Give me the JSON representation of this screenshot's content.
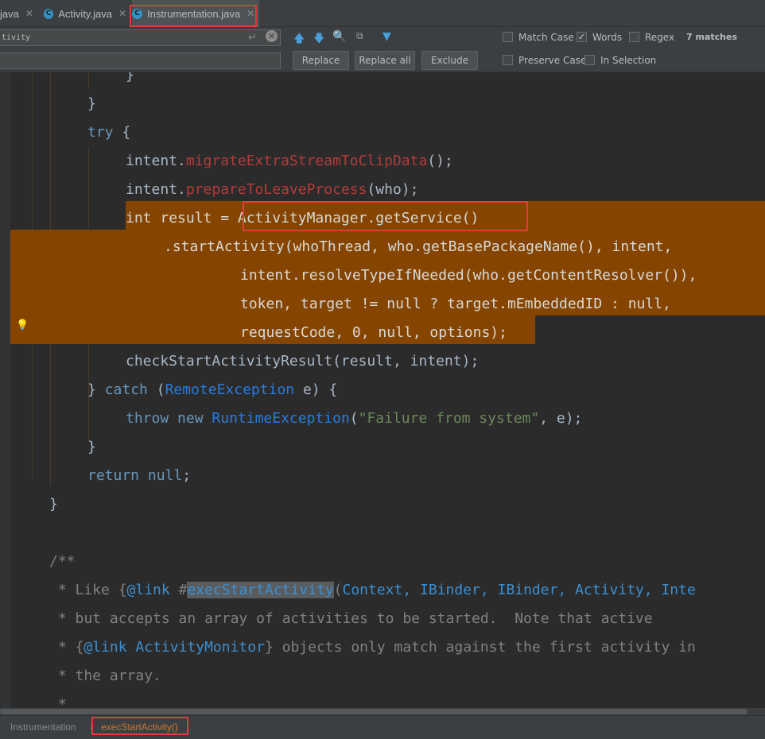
{
  "tabs": [
    {
      "label": "java",
      "active": false
    },
    {
      "label": "Activity.java",
      "active": false
    },
    {
      "label": "Instrumentation.java",
      "active": true
    }
  ],
  "find": {
    "search_value": "tivity",
    "replace_value": "",
    "replace_label": "Replace",
    "replace_all_label": "Replace all",
    "exclude_label": "Exclude",
    "match_case_label": "Match Case",
    "words_label": "Words",
    "regex_label": "Regex",
    "preserve_case_label": "Preserve Case",
    "in_selection_label": "In Selection",
    "matches": "7 matches",
    "match_case_checked": false,
    "words_checked": true,
    "regex_checked": false,
    "preserve_case_checked": false,
    "in_selection_checked": false
  },
  "code": {
    "l0": "}",
    "l1": "}",
    "l2_kw": "try",
    "l2_rest": " {",
    "l3_a": "intent.",
    "l3_m": "migrateExtraStreamToClipData",
    "l3_b": "();",
    "l4_a": "intent.",
    "l4_m": "prepareToLeaveProcess",
    "l4_b": "(who);",
    "l5_kw": "int",
    "l5_a": " result = ",
    "l5_b": "ActivityManager.getService()",
    "l6": ".startActivity(whoThread, who.getBasePackageName(), intent,",
    "l7": "intent.resolveTypeIfNeeded(who.getContentResolver()),",
    "l8_a": "token, target != ",
    "l8_n1": "null",
    "l8_b": " ? target.mEmbeddedID : ",
    "l8_n2": "null",
    "l8_c": ",",
    "l9_a": "requestCode, 0, ",
    "l9_n": "null",
    "l9_b": ", options);",
    "l10": "checkStartActivityResult(result, intent);",
    "l11_a": "} ",
    "l11_kw": "catch",
    "l11_b": " (",
    "l11_cls": "RemoteException",
    "l11_c": " e) {",
    "l12_kw1": "throw",
    "l12_sp1": " ",
    "l12_kw2": "new",
    "l12_sp2": " ",
    "l12_cls": "RuntimeException",
    "l12_a": "(",
    "l12_str": "\"Failure from system\"",
    "l12_b": ", e);",
    "l13": "}",
    "l14_kw": "return",
    "l14_sp": " ",
    "l14_null": "null",
    "l14_b": ";",
    "l15": "}",
    "l16": "/**",
    "l17_a": " * Like {",
    "l17_tag": "@link",
    "l17_b": " #",
    "l17_match": "execStartActivity",
    "l17_c": "(",
    "l17_d": "Context, IBinder, IBinder, Activity, Inte",
    "l18": " * but accepts an array of activities to be started.  Note that active",
    "l19_a": " * {",
    "l19_tag": "@link",
    "l19_b": " ",
    "l19_cls": "ActivityMonitor",
    "l19_c": "} objects only match against the first activity in",
    "l20": " * the array.",
    "l21": " *"
  },
  "breadcrumb": {
    "item1": "Instrumentation",
    "separator": "›",
    "item2": "execStartActivity()"
  },
  "colors": {
    "selection": "#854500",
    "annotation_box": "#e03c3c",
    "keyword": "#cc7832",
    "string": "#6a8759",
    "comment": "#808080"
  }
}
